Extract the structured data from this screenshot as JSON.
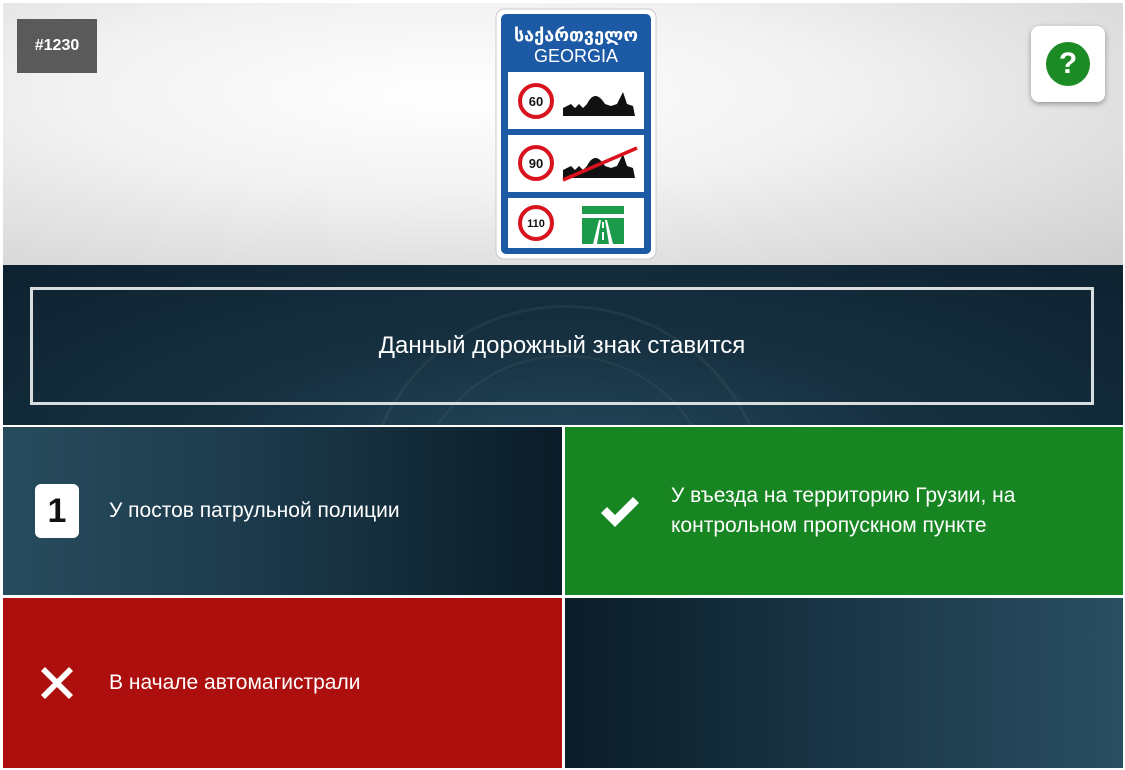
{
  "question": {
    "number": "#1230",
    "text": "Данный дорожный знак ставится"
  },
  "help_button": {
    "label": "?"
  },
  "sign": {
    "header_georgian": "საქართველო",
    "header_latin": "GEORGIA",
    "rows": [
      {
        "speed": "60",
        "icon": "town-silhouette-icon"
      },
      {
        "speed": "90",
        "icon": "town-silhouette-crossed-icon"
      },
      {
        "speed": "110",
        "icon": "motorway-icon"
      }
    ],
    "colors": {
      "frame": "#1d5aa6",
      "speed_ring": "#d9121e",
      "motorway": "#1a9a4a"
    }
  },
  "answers": [
    {
      "marker": "1",
      "text": "У постов патрульной полиции",
      "state": "neutral"
    },
    {
      "marker": "check-icon",
      "text": "У въезда на территорию Грузии, на контрольном пропускном пункте",
      "state": "correct"
    },
    {
      "marker": "cross-icon",
      "text": "В начале автомагистрали",
      "state": "wrong"
    },
    {
      "marker": "",
      "text": "",
      "state": "empty"
    }
  ],
  "colors": {
    "correct": "#178622",
    "wrong": "#ad0f0f",
    "question_bg": "#163040"
  }
}
